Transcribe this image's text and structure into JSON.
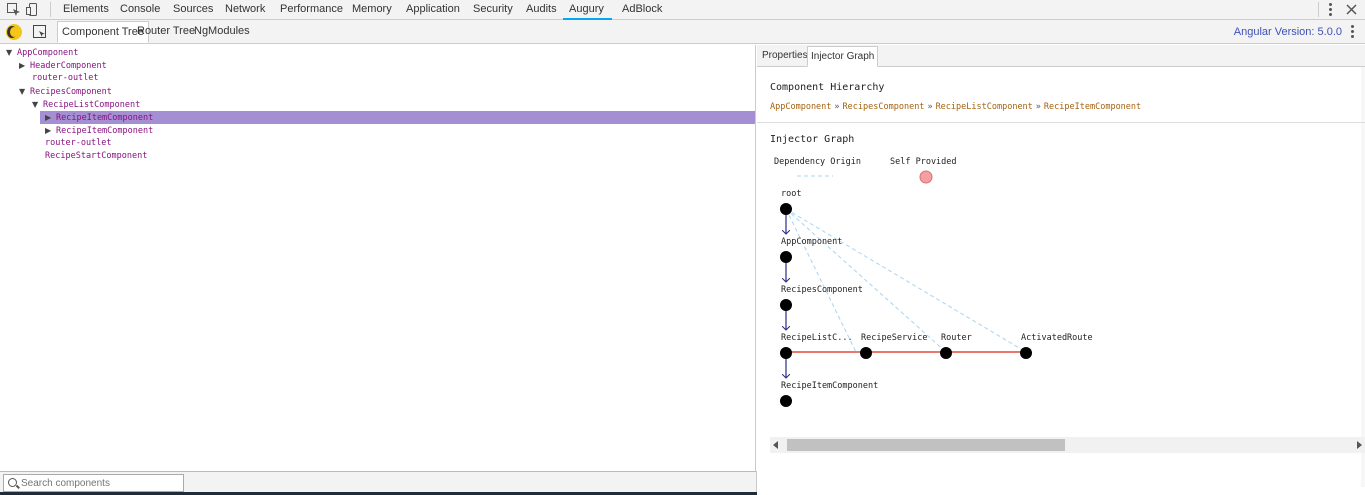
{
  "devtools": {
    "tabs": [
      "Elements",
      "Console",
      "Sources",
      "Network",
      "Performance",
      "Memory",
      "Application",
      "Security",
      "Audits",
      "Augury",
      "AdBlock"
    ],
    "active_tab": "Augury"
  },
  "augury": {
    "tabs": [
      "Component Tree",
      "Router Tree",
      "NgModules"
    ],
    "active_tab": "Component Tree",
    "version_text": "Angular Version: 5.0.0"
  },
  "tree": [
    {
      "label": "AppComponent",
      "caret": "▼",
      "depth": 0,
      "selected": false
    },
    {
      "label": "HeaderComponent",
      "caret": "▶",
      "depth": 1,
      "selected": false
    },
    {
      "label": "router-outlet",
      "caret": "",
      "depth": 1,
      "selected": false
    },
    {
      "label": "RecipesComponent",
      "caret": "▼",
      "depth": 1,
      "selected": false
    },
    {
      "label": "RecipeListComponent",
      "caret": "▼",
      "depth": 2,
      "selected": false
    },
    {
      "label": "RecipeItemComponent",
      "caret": "▶",
      "depth": 3,
      "selected": true
    },
    {
      "label": "RecipeItemComponent",
      "caret": "▶",
      "depth": 3,
      "selected": false
    },
    {
      "label": "router-outlet",
      "caret": "",
      "depth": 2,
      "selected": false
    },
    {
      "label": "RecipeStartComponent",
      "caret": "",
      "depth": 2,
      "selected": false
    }
  ],
  "search": {
    "placeholder": "Search components",
    "value": ""
  },
  "details": {
    "tabs": [
      "Properties",
      "Injector Graph"
    ],
    "active_tab": "Injector Graph",
    "hierarchy_title": "Component Hierarchy",
    "breadcrumb": [
      "AppComponent",
      "RecipesComponent",
      "RecipeListComponent",
      "RecipeItemComponent"
    ],
    "breadcrumb_separator": "»",
    "graph_title": "Injector Graph",
    "legend": {
      "dependency_origin": "Dependency Origin",
      "self_provided": "Self Provided"
    },
    "nodes": [
      "root",
      "AppComponent",
      "RecipesComponent",
      "RecipeListC...",
      "RecipeService",
      "Router",
      "ActivatedRoute",
      "RecipeItemComponent"
    ]
  },
  "colors": {
    "accent_tab": "#03a9f4",
    "selected_row": "#a48fd2",
    "component_text": "#881280",
    "breadcrumb_text": "#a5620f",
    "provider_edge": "#e8776e",
    "dependency_edge": "#a8d4f0",
    "hierarchy_edge": "#2a2a8c",
    "self_provided": "#f4a0a0",
    "version_text": "#3f51b5"
  }
}
